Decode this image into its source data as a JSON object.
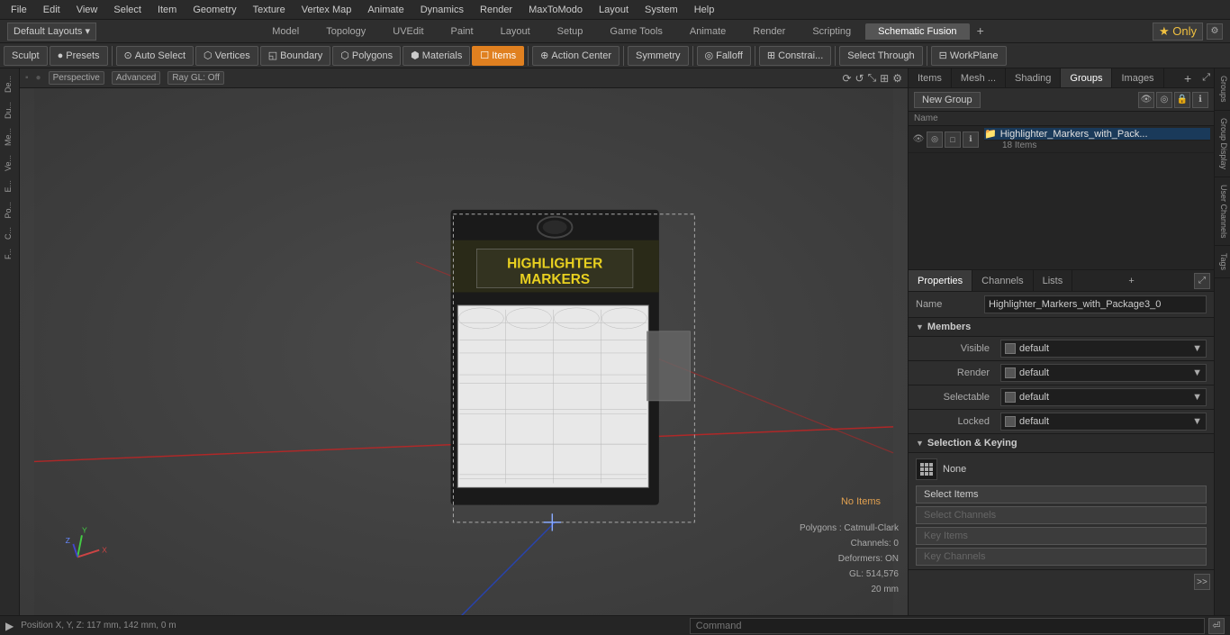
{
  "menubar": {
    "items": [
      "File",
      "Edit",
      "View",
      "Select",
      "Item",
      "Geometry",
      "Texture",
      "Vertex Map",
      "Animate",
      "Dynamics",
      "Render",
      "MaxToModo",
      "Layout",
      "System",
      "Help"
    ]
  },
  "layout_bar": {
    "dropdown_label": "Default Layouts ▾",
    "tabs": [
      "Model",
      "Topology",
      "UVEdit",
      "Paint",
      "Layout",
      "Setup",
      "Game Tools",
      "Animate",
      "Render",
      "Scripting",
      "Schematic Fusion"
    ],
    "star_label": "★ Only",
    "plus_label": "+"
  },
  "toolbar": {
    "sculpt_label": "Sculpt",
    "presets_label": "Presets",
    "auto_select_label": "Auto Select",
    "vertices_label": "Vertices",
    "boundary_label": "Boundary",
    "polygons_label": "Polygons",
    "materials_label": "Materials",
    "items_label": "Items",
    "action_center_label": "Action Center",
    "symmetry_label": "Symmetry",
    "falloff_label": "Falloff",
    "constrain_label": "Constrai...",
    "select_through_label": "Select Through",
    "workplane_label": "WorkPlane"
  },
  "viewport": {
    "view_mode": "Perspective",
    "view_type": "Advanced",
    "ray_gl": "Ray GL: Off",
    "no_items_label": "No Items",
    "polygons_info": "Polygons : Catmull-Clark",
    "channels_info": "Channels: 0",
    "deformers_info": "Deformers: ON",
    "gl_info": "GL: 514,576",
    "scale_info": "20 mm",
    "coords_label": "Position X, Y, Z:  117 mm, 142 mm, 0 m"
  },
  "right_panel": {
    "tabs": [
      "Items",
      "Mesh ...",
      "Shading",
      "Groups",
      "Images"
    ],
    "expand_icon": "⤢",
    "group_section": {
      "new_group_btn": "New Group",
      "name_col": "Name"
    },
    "group_item": {
      "name": "Highlighter_Markers_with_Pack...",
      "count": "18 Items"
    },
    "props_tabs": [
      "Properties",
      "Channels",
      "Lists",
      "+"
    ],
    "name_label": "Name",
    "name_value": "Highlighter_Markers_with_Package3_0",
    "members_section": "Members",
    "visible_label": "Visible",
    "visible_value": "default",
    "render_label": "Render",
    "render_value": "default",
    "selectable_label": "Selectable",
    "selectable_value": "default",
    "locked_label": "Locked",
    "locked_value": "default",
    "sel_keying_section": "Selection & Keying",
    "none_label": "None",
    "select_items_btn": "Select Items",
    "select_channels_btn": "Select Channels",
    "key_items_btn": "Key Items",
    "key_channels_btn": "Key Channels"
  },
  "right_edge_tabs": [
    "Groups",
    "Group Display",
    "User Channels",
    "Tags"
  ],
  "bottom_bar": {
    "command_placeholder": "Command",
    "arrow_label": "▶"
  },
  "left_tabs": [
    "De...",
    "Du...",
    "Me...",
    "Ve...",
    "E...",
    "Po...",
    "C...",
    "F..."
  ]
}
